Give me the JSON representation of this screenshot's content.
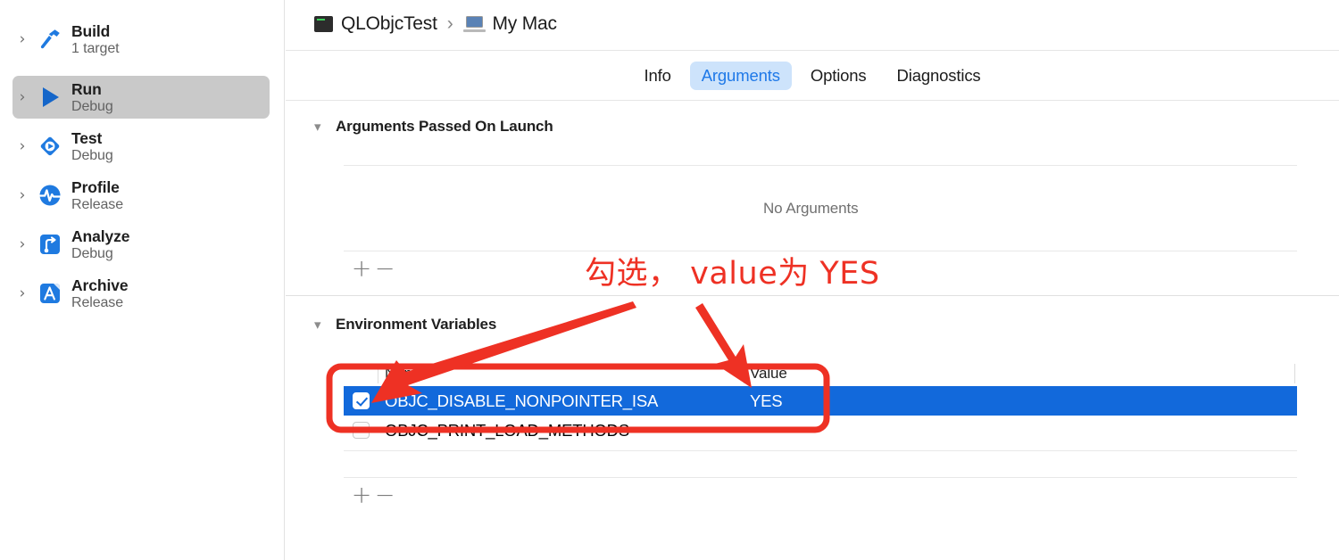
{
  "sidebar": {
    "items": [
      {
        "title": "Build",
        "subtitle": "1 target",
        "icon": "hammer-icon",
        "selected": false
      },
      {
        "title": "Run",
        "subtitle": "Debug",
        "icon": "play-icon",
        "selected": true
      },
      {
        "title": "Test",
        "subtitle": "Debug",
        "icon": "test-diamond-icon",
        "selected": false
      },
      {
        "title": "Profile",
        "subtitle": "Release",
        "icon": "profile-pulse-icon",
        "selected": false
      },
      {
        "title": "Analyze",
        "subtitle": "Debug",
        "icon": "analyze-icon",
        "selected": false
      },
      {
        "title": "Archive",
        "subtitle": "Release",
        "icon": "archive-icon",
        "selected": false
      }
    ]
  },
  "breadcrumb": {
    "scheme": "QLObjcTest",
    "separator": "›",
    "destination": "My Mac"
  },
  "tabs": [
    {
      "label": "Info",
      "active": false
    },
    {
      "label": "Arguments",
      "active": true
    },
    {
      "label": "Options",
      "active": false
    },
    {
      "label": "Diagnostics",
      "active": false
    }
  ],
  "arguments_section": {
    "title": "Arguments Passed On Launch",
    "empty_message": "No Arguments",
    "add_label": "+",
    "remove_label": "−"
  },
  "environment_section": {
    "title": "Environment Variables",
    "columns": {
      "name": "Name",
      "value": "Value"
    },
    "rows": [
      {
        "checked": true,
        "selected": true,
        "name": "OBJC_DISABLE_NONPOINTER_ISA",
        "value": "YES"
      },
      {
        "checked": false,
        "selected": false,
        "name": "OBJC_PRINT_LOAD_METHODS",
        "value": ""
      }
    ],
    "add_label": "+",
    "remove_label": "−"
  },
  "annotation": {
    "text": "勾选， value为 YES",
    "color": "#EE3124"
  },
  "colors": {
    "selection_blue": "#1269DB",
    "tab_active_bg": "#CDE3FB",
    "tab_active_text": "#1F79E8",
    "sidebar_selected": "#C9C9C9",
    "annotation_red": "#EE3124"
  }
}
